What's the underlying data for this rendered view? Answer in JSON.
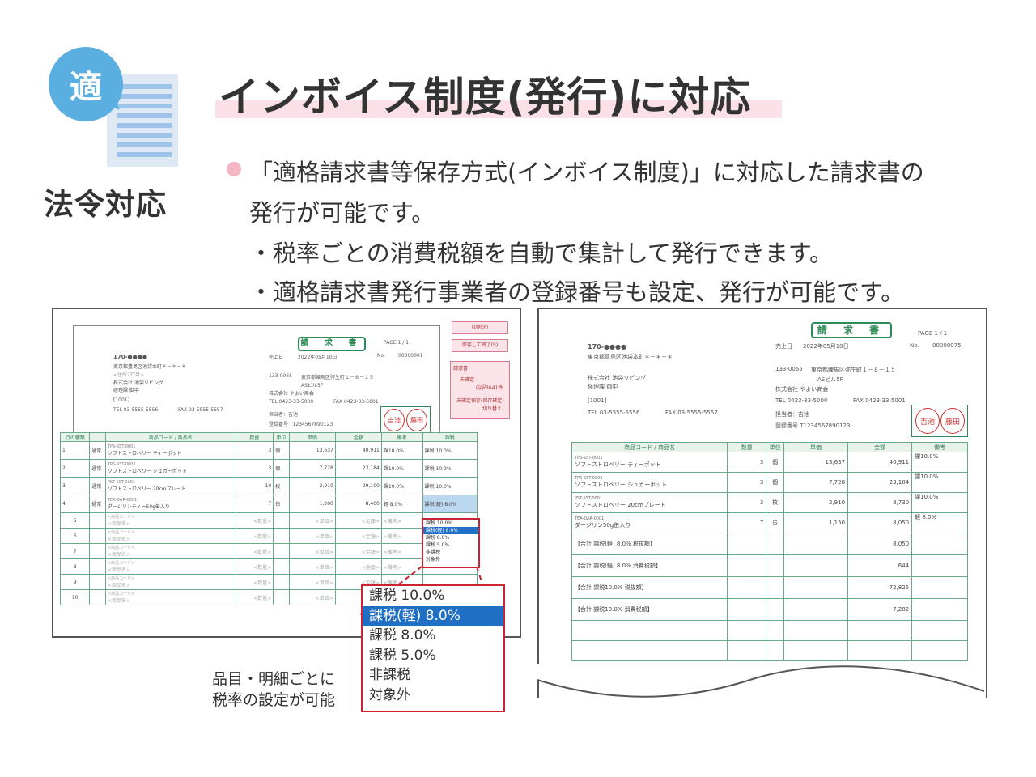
{
  "badge": {
    "char": "適"
  },
  "category_label": "法令対応",
  "title": "インボイス制度(発行)に対応",
  "bullets": {
    "line1": "「適格請求書等保存方式(インボイス制度)」に対応した請求書の",
    "line2": "発行が可能です。",
    "sub1": "・税率ごとの消費税額を自動で集計して発行できます。",
    "sub2": "・適格請求書発行事業者の登録番号も設定、発行が可能です。"
  },
  "form": {
    "title": "請 求 書",
    "page": "PAGE 1 / 1",
    "postal": "170-●●●●",
    "addr": "東京都豊島区池袋本町＊－＊－＊",
    "sub_addr": "<住所2行目>",
    "company": "株式会社 池袋リビング",
    "dept": "経理課 御中",
    "code": "[1001]",
    "tel": "TEL 03-5555-5556",
    "fax": "FAX 03-5555-5557",
    "date_label": "売上日",
    "date": "2022年05月10日",
    "no_label": "No.",
    "no": "00000001",
    "issuer_postal": "133-0065",
    "issuer_addr": "東京都練馬区弥生町１－８－１５",
    "issuer_bldg": "ASビル5F",
    "issuer_company": "株式会社 やよい商会",
    "issuer_tel": "TEL 0423-33-5000",
    "issuer_fax": "FAX 0423-33-5001",
    "contact": "担当者：吉池",
    "reg_no": "登録番号 T1234567890123",
    "stamp1": "吉池",
    "stamp2": "藤田",
    "side_buttons": [
      "印刷(P)",
      "保存して終了(S)"
    ],
    "side_box_title": "請求書",
    "side_box_line1": "未確定",
    "side_box_line2": "内訳3641件",
    "side_box_line3": "未確定保存(保存確定)",
    "side_box_line4": "切り替え",
    "side_col_label": "行の種類",
    "headers": [
      "商品コード / 商品名",
      "数量",
      "単位",
      "単価",
      "金額",
      "備考"
    ],
    "tax_header": "課税",
    "rows": [
      {
        "no": "1",
        "type": "通常",
        "code": "TPS-SST-0001",
        "name": "ソフトストロベリー ティーポット",
        "qty": "3",
        "unit": "個",
        "price": "13,637",
        "amount": "40,911",
        "note": "課10.0%",
        "tax": "課税 10.0%"
      },
      {
        "no": "2",
        "type": "通常",
        "code": "TPS-SST-0002",
        "name": "ソフトストロベリー シュガーポット",
        "qty": "3",
        "unit": "個",
        "price": "7,728",
        "amount": "23,184",
        "note": "課10.0%",
        "tax": "課税 10.0%"
      },
      {
        "no": "3",
        "type": "通常",
        "code": "PST-SST-0001",
        "name": "ソフトストロベリー 20cmプレート",
        "qty": "10",
        "unit": "枚",
        "price": "2,910",
        "amount": "29,100",
        "note": "課10.0%",
        "tax": "課税 10.0%"
      },
      {
        "no": "4",
        "type": "通常",
        "code": "TEA-DAR-0001",
        "name": "ダージリンティー50g缶入り",
        "qty": "7",
        "unit": "缶",
        "price": "1,200",
        "amount": "8,400",
        "note": "軽 8.0%",
        "tax": "課税(軽) 8.0%"
      }
    ],
    "empty_rows": [
      "5",
      "6",
      "7",
      "8",
      "9",
      "10"
    ],
    "placeholder_code": "<商品コード>",
    "placeholder_name": "<商品名>",
    "placeholder_qty": "<数量>",
    "placeholder_price": "<単価>",
    "placeholder_amount": "<金額>",
    "placeholder_note": "<備考>",
    "small_dropdown": [
      "課税 10.0%",
      "課税(軽) 8.0%",
      "課税 8.0%",
      "課税 5.0%",
      "非課税",
      "対象外"
    ]
  },
  "dropdown": {
    "options": [
      "課税 10.0%",
      "課税(軽) 8.0%",
      "課税 8.0%",
      "課税 5.0%",
      "非課税",
      "対象外"
    ],
    "selected_index": 1
  },
  "caption": {
    "line1": "品目・明細ごとに",
    "line2": "税率の設定が可能"
  },
  "invoice": {
    "title": "請 求 書",
    "page": "PAGE 1 / 1",
    "postal": "170-●●●●",
    "addr": "東京都豊島区池袋本町＊－＊－＊",
    "company": "株式会社 池袋リビング",
    "dept": "経理課 御中",
    "code": "[1001]",
    "tel": "TEL 03-5555-5556",
    "fax": "FAX 03-5555-5557",
    "date_label": "売上日",
    "date": "2022年05月10日",
    "no_label": "No.",
    "no": "00000075",
    "issuer_postal": "133-0065",
    "issuer_addr": "東京都練馬区弥生町１－８－１５",
    "issuer_bldg": "ASビル5F",
    "issuer_company": "株式会社 やよい商会",
    "issuer_tel": "TEL 0423-33-5000",
    "issuer_fax": "FAX 0423-33-5001",
    "contact": "担当者：吉池",
    "reg_no": "登録番号 T1234567890123",
    "stamp1": "吉池",
    "stamp2": "藤田",
    "headers": [
      "商品コード / 商品名",
      "数量",
      "単位",
      "単価",
      "金額",
      "備考"
    ],
    "rows": [
      {
        "code": "TPS-SST-0001",
        "name": "ソフトストロベリー ティーポット",
        "qty": "3",
        "unit": "個",
        "price": "13,637",
        "amount": "40,911",
        "note": "課10.0%"
      },
      {
        "code": "TPS-SST-0002",
        "name": "ソフトストロベリー シュガーポット",
        "qty": "3",
        "unit": "個",
        "price": "7,728",
        "amount": "23,184",
        "note": "課10.0%"
      },
      {
        "code": "PST-SST-0001",
        "name": "ソフトストロベリー 20cmプレート",
        "qty": "3",
        "unit": "枚",
        "price": "2,910",
        "amount": "8,730",
        "note": "課10.0%"
      },
      {
        "code": "TEA-DAR-0001",
        "name": "ダージリン50g缶入り",
        "qty": "7",
        "unit": "缶",
        "price": "1,150",
        "amount": "8,050",
        "note": "軽 8.0%"
      }
    ],
    "summary": [
      {
        "label": "【合計 課税(軽) 8.0% 税抜額】",
        "value": "8,050"
      },
      {
        "label": "【合計 課税(軽) 8.0% 消費税額】",
        "value": "644"
      },
      {
        "label": "【合計 課税10.0% 税抜額】",
        "value": "72,825"
      },
      {
        "label": "【合計 課税10.0% 消費税額】",
        "value": "7,282"
      }
    ]
  }
}
